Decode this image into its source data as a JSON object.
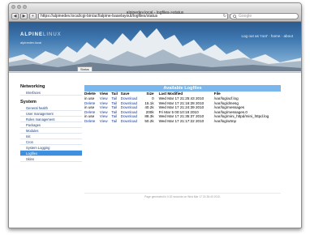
{
  "window": {
    "title": "alpinedev.local - logfiles->status"
  },
  "toolbar": {
    "back": "◀",
    "forward": "▶",
    "add": "+",
    "url": "https://alpinedev.local/cgi-bin/acf/alpine-baselayout/logfiles/status",
    "reload": "↻",
    "search_placeholder": "Google"
  },
  "banner": {
    "brand_main": "ALPINE",
    "brand_thin": "LINUX",
    "host": "alpinedev.local",
    "user_links": "Log out as 'root' · home · about",
    "active_tab": "Status"
  },
  "sidebar": {
    "sections": [
      {
        "heading": "Networking",
        "items": [
          "Interfaces"
        ]
      },
      {
        "heading": "System",
        "items": [
          "General health",
          "User management",
          "Roles management",
          "Packages",
          "Modules",
          "Init",
          "Cron",
          "System Logging",
          "Logfiles",
          "Skins"
        ]
      }
    ],
    "active_item": "Logfiles"
  },
  "logfiles": {
    "title": "Available Logfiles",
    "columns": [
      "Delete",
      "View",
      "Tail",
      "Save",
      "Size",
      "Last Modified",
      "File"
    ],
    "rows": [
      {
        "delete": "in use",
        "view": "View",
        "tail": "Tail",
        "save": "Download",
        "size": "0",
        "modified": "Wed Mar 17 21:25:43 2010",
        "file": "/var/log/acf.log"
      },
      {
        "delete": "Delete",
        "view": "View",
        "tail": "Tail",
        "save": "Download",
        "size": "15.1k",
        "modified": "Wed Mar 17 21:16:28 2010",
        "file": "/var/log/dmesg"
      },
      {
        "delete": "in use",
        "view": "View",
        "tail": "Tail",
        "save": "Download",
        "size": "40.2k",
        "modified": "Wed Mar 17 21:24:39 2010",
        "file": "/var/log/messages"
      },
      {
        "delete": "Delete",
        "view": "View",
        "tail": "Tail",
        "save": "Download",
        "size": "200k",
        "modified": "Fri Mar 5 00:10:18 2010",
        "file": "/var/log/messages.0"
      },
      {
        "delete": "in use",
        "view": "View",
        "tail": "Tail",
        "save": "Download",
        "size": "88.3k",
        "modified": "Wed Mar 17 21:35:37 2010",
        "file": "/var/log/mini_httpd/mini_httpd.log"
      },
      {
        "delete": "Delete",
        "view": "View",
        "tail": "Tail",
        "save": "Download",
        "size": "50.2k",
        "modified": "Wed Mar 17 21:17:22 2010",
        "file": "/var/log/wtmp"
      }
    ]
  },
  "footer": {
    "text": "Page generated in 0.02 seconds on Wed Mar 17 21:35:40 2010."
  },
  "colors": {
    "accent": "#3d8fdf",
    "table_header": "#79b7ec",
    "link": "#1b3d9a"
  }
}
